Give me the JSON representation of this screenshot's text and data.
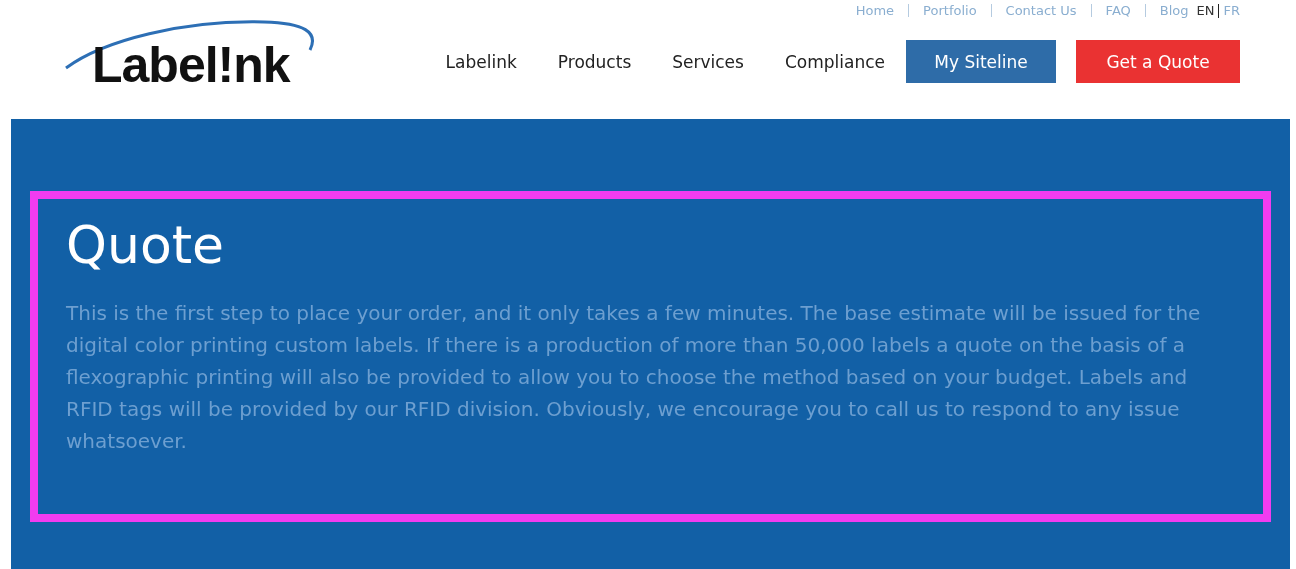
{
  "logo": {
    "text": "Label!nk"
  },
  "top_links": [
    "Home",
    "Portfolio",
    "Contact Us",
    "FAQ",
    "Blog"
  ],
  "languages": [
    {
      "label": "EN",
      "selected": true
    },
    {
      "label": "FR",
      "selected": false
    }
  ],
  "nav": [
    "Labelink",
    "Products",
    "Services",
    "Compliance"
  ],
  "buttons": [
    {
      "label": "My Siteline",
      "kind": "secondary"
    },
    {
      "label": "Get a Quote",
      "kind": "primary"
    }
  ],
  "hero": {
    "title": "Quote",
    "text": "This is the first step to place your order, and it only takes a few minutes. The base estimate will be issued for the digital color printing custom labels. If there is a production of more than 50,000 labels a quote on the basis of a flexographic printing will also be provided to allow you to choose the method based on your budget. Labels and RFID tags will be provided by our RFID division. Obviously, we encourage you to call us to respond to any issue whatsoever."
  }
}
